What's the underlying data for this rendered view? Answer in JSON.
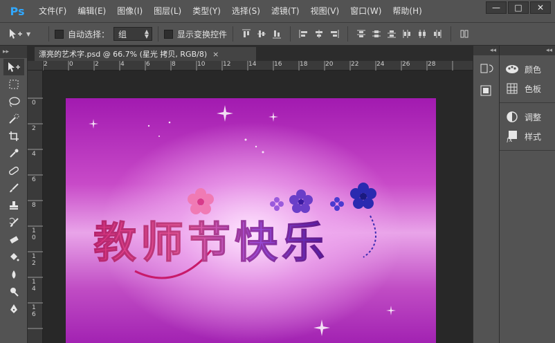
{
  "app": {
    "logo": "Ps",
    "window_controls": {
      "minimize": "—",
      "maximize": "□",
      "close": "✕"
    }
  },
  "menu": [
    "文件(F)",
    "编辑(E)",
    "图像(I)",
    "图层(L)",
    "类型(Y)",
    "选择(S)",
    "滤镜(T)",
    "视图(V)",
    "窗口(W)",
    "帮助(H)"
  ],
  "options": {
    "auto_select_label": "自动选择：",
    "auto_select_value": "组",
    "show_transform_label": "显示变换控件"
  },
  "document": {
    "tab_title": "漂亮的艺术字.psd @ 66.7% (星光 拷贝, RGB/8)",
    "close": "×"
  },
  "ruler": {
    "top_labels": [
      "2",
      "0",
      "2",
      "4",
      "6",
      "8",
      "10",
      "12",
      "14",
      "16",
      "18",
      "20",
      "22",
      "24",
      "26",
      "28"
    ],
    "left_labels": [
      "0",
      "2",
      "4",
      "6",
      "8",
      "1 0",
      "1 2",
      "1 4",
      "1 6"
    ]
  },
  "artwork": {
    "text": "教师节快乐",
    "colors": {
      "text_pink": "#e44a9a",
      "text_purple": "#5a1ba8",
      "bg_top": "#a21ab0",
      "bg_mid": "#e9a4e9"
    }
  },
  "panels": {
    "group1": [
      {
        "icon": "color-icon",
        "label": "颜色"
      },
      {
        "icon": "swatches-icon",
        "label": "色板"
      }
    ],
    "group2": [
      {
        "icon": "adjustments-icon",
        "label": "调整"
      },
      {
        "icon": "styles-icon",
        "label": "样式"
      }
    ]
  },
  "colors": {
    "ps_blue": "#31a8ff",
    "ui_gray": "#535353",
    "canvas_bg": "#282828"
  }
}
